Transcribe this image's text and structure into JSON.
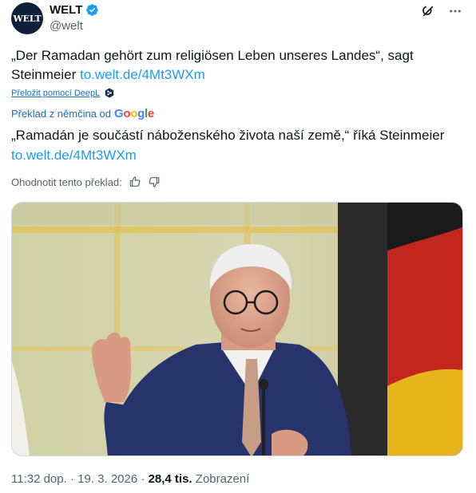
{
  "account": {
    "avatar_text": "WELT",
    "display_name": "WELT",
    "handle": "@welt",
    "verified_icon": "verified-badge-icon"
  },
  "top_icons": [
    "grok-icon",
    "more-icon"
  ],
  "tweet": {
    "text": "„Der Ramadan gehört zum religiösen Leben unseres Landes“, sagt Steinmeier ",
    "link": "to.welt.de/4Mt3WXm"
  },
  "translate": {
    "deepl_label": "Přeložit pomocí DeepL",
    "translated_by": "Překlad z němčina od",
    "provider": "Google",
    "translated_text": "„Ramadán je součástí náboženského života naší země,“ říká Steinmeier ",
    "translated_link": "to.welt.de/4Mt3WXm",
    "rate_label": "Ohodnotit tento překlad:"
  },
  "footer": {
    "time": "11:32 dop.",
    "sep1": " · ",
    "date": "19. 3. 2026",
    "sep2": " · ",
    "views_count": "28,4 tis.",
    "views_label": " Zobrazení"
  },
  "colors": {
    "link": "#1d9bf0",
    "avatar_bg": "#0e1f3a",
    "muted": "#536471"
  }
}
